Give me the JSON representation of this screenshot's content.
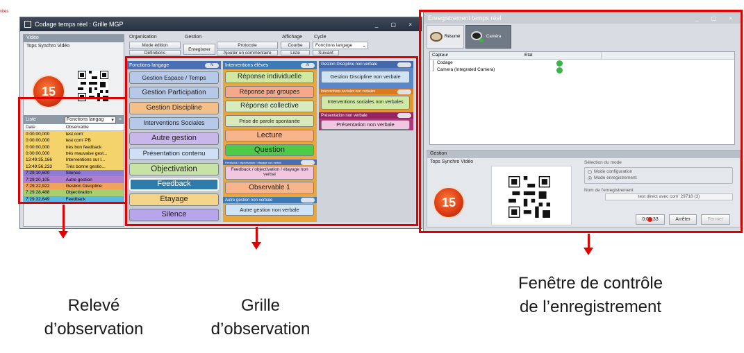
{
  "corner_label": "vités",
  "main_window": {
    "title": "Codage temps réel : Grille MGP",
    "controls": "_ ▢ ×",
    "video_label": "Vidéo",
    "tops_label": "Tops Synchro Vidéo",
    "counter": "15",
    "toolbar": {
      "organisation": "Organisation",
      "gestion": "Gestion",
      "affichage": "Affichage",
      "cycle": "Cycle",
      "mode_edition": "Mode édition",
      "definition": "Définitions",
      "enregistrer": "Enregistrer",
      "protocole": "Protocole",
      "ajouter_commentaire": "Ajouter un commentaire",
      "courbe": "Courbe",
      "liste": "Liste",
      "cycle_value": "Fonctions langage",
      "suivant": "Suivant"
    },
    "list": {
      "title": "Liste",
      "filter": "Fonctions langag",
      "col_date": "Date",
      "col_obs": "Observable",
      "rows": [
        {
          "date": "0:00:00,000",
          "obs": "test com'",
          "color": "#f4d36b"
        },
        {
          "date": "0:00:00,000",
          "obs": "test com' PB",
          "color": "#f4d36b"
        },
        {
          "date": "0:00:00,000",
          "obs": "très bon feedback",
          "color": "#f4d36b"
        },
        {
          "date": "0:00:00,000",
          "obs": "très mauvaise gest...",
          "color": "#f4d36b"
        },
        {
          "date": "13:49:35,166",
          "obs": "Interventions sur l...",
          "color": "#f4d36b"
        },
        {
          "date": "13:49:56,233",
          "obs": "Très bonne gestio...",
          "color": "#f4d36b"
        },
        {
          "date": "7:29:10,600",
          "obs": "Silence",
          "color": "#8e7bd6"
        },
        {
          "date": "7:29:20,105",
          "obs": "Autre gestion",
          "color": "#b07fd0"
        },
        {
          "date": "7:29:22,922",
          "obs": "Gestion Discipline",
          "color": "#f0a35a"
        },
        {
          "date": "7:29:28,488",
          "obs": "Objectivation",
          "color": "#a7cf6f"
        },
        {
          "date": "7:29:32,649",
          "obs": "Feedback",
          "color": "#5ab8e6"
        }
      ]
    }
  },
  "grid": {
    "col1": {
      "header": "Fonctions langage",
      "toggle": "N",
      "buttons": [
        "Gestion Espace / Temps",
        "Gestion Participation",
        "Gestion Discipline",
        "Interventions Sociales",
        "Autre gestion",
        "Présentation contenu",
        "Objectivation",
        "Feedback",
        "Etayage",
        "Silence"
      ]
    },
    "col2": {
      "header": "Interventions élèves",
      "toggle": "N",
      "buttons": [
        "Réponse individuelle",
        "Réponse par groupes",
        "Réponse collective",
        "Prise de parole spontanée",
        "Lecture",
        "Question"
      ],
      "sub_header": "Feedback / objectivation / étayage non verbal",
      "sub_buttons": [
        "Feedback / objectivation / étayage non verbal",
        "Observable 1"
      ],
      "sub2_header": "Autre gestion non verbale",
      "sub2_buttons": [
        "Autre gestion non verbale"
      ]
    },
    "col3": {
      "header1": "Gestion Discipline non verbale",
      "btn1": "Gestion Discipline non verbale",
      "header2": "Interventions sociales non verbales",
      "btn2": "Interventions sociales non verbales",
      "header3": "Présentation non verbale",
      "btn3": "Présentation non verbale"
    }
  },
  "rec_window": {
    "title": "Enregistrement temps réel",
    "controls": "_ ▢ ×",
    "tab_resume": "Résumé",
    "tab_camera": "Caméra",
    "col_capteur": "Capteur",
    "col_etat": "Etat",
    "sensors": [
      "Codage",
      "Camera (Integrated Camera)"
    ],
    "gestion_label": "Gestion",
    "tops_label": "Tops Synchro Vidéo",
    "counter": "15",
    "mode_title": "Sélection du mode",
    "mode_config": "Mode configuration",
    "mode_record": "Mode enregistrement",
    "name_label": "Nom de l'enregistrement",
    "name_value": "test direct avec com' 29718 (3)",
    "timer": "0:00:33",
    "stop": "Arrêter",
    "close": "Fermer"
  },
  "captions": {
    "left": "Relevé d’observation",
    "middle": "Grille d’observation",
    "right": "Fenêtre de contrôle de l’enregistrement"
  }
}
